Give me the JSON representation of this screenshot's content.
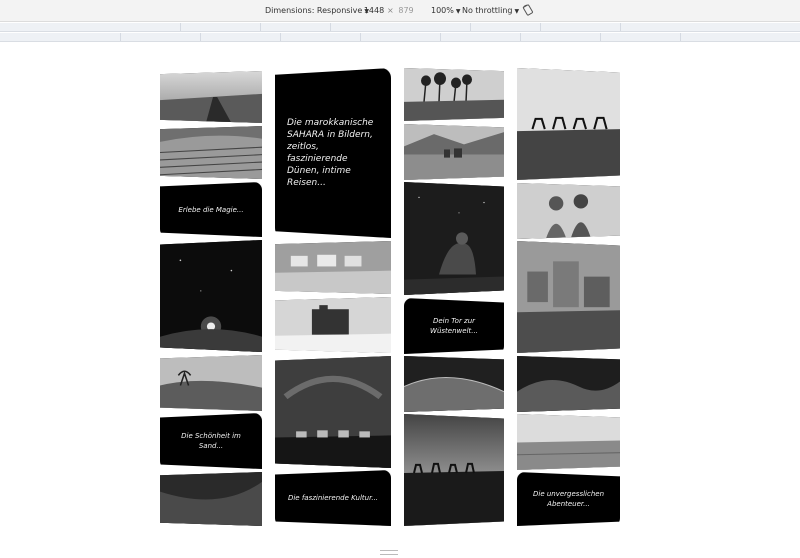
{
  "devtools": {
    "dimensions_label": "Dimensions: Responsive",
    "width_value": "1448",
    "times_sign": "×",
    "height_value": "879",
    "zoom": "100%",
    "throttling": "No throttling"
  },
  "gallery": {
    "hero_text": "Die marokkanische SAHARA in Bildern, zeitlos, faszinierende Dünen, intime Reisen...",
    "caption_magic": "Erlebe die Magie...",
    "caption_gate": "Dein Tor zur Wüstenwelt...",
    "caption_beauty": "Die Schönheit im Sand...",
    "caption_culture": "Die faszinierende Kultur...",
    "caption_adventure": "Die unvergesslichen Abenteuer..."
  }
}
